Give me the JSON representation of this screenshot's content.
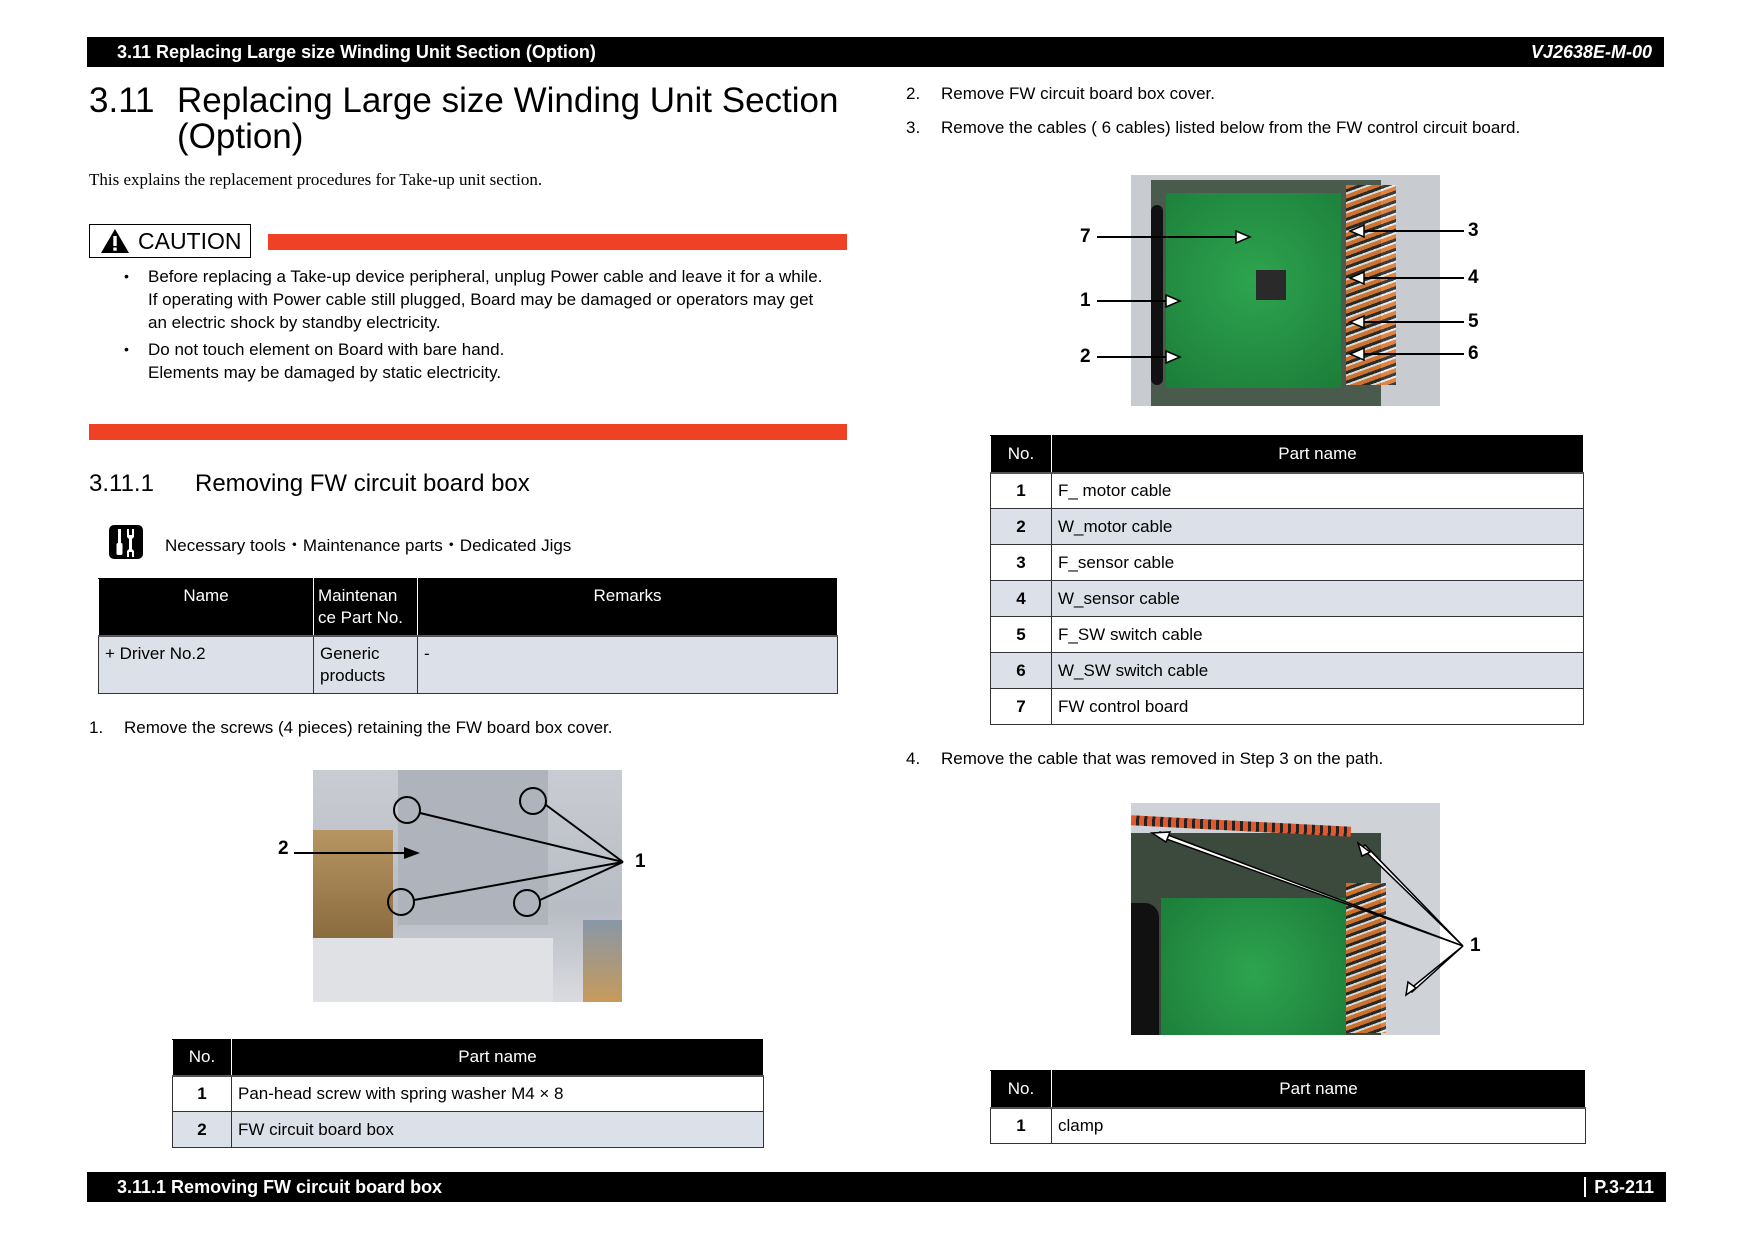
{
  "header": {
    "section": "3.11 Replacing Large size Winding Unit Section (Option)",
    "doc_code": "VJ2638E-M-00"
  },
  "title": {
    "number": "3.11",
    "text": "Replacing Large size Winding Unit Section (Option)"
  },
  "intro": "This explains the replacement procedures for Take-up unit section.",
  "caution": {
    "label": "CAUTION",
    "items": [
      {
        "line1": "Before replacing a Take-up device peripheral, unplug Power cable and leave it for a while.",
        "line2": "If operating with Power cable still plugged, Board may be damaged or operators may get an electric shock by standby electricity."
      },
      {
        "line1": "Do not touch element on Board with bare hand.",
        "line2": "Elements may be damaged by static electricity."
      }
    ],
    "accent_color": "#EF4123"
  },
  "subsection": {
    "number": "3.11.1",
    "title": "Removing FW circuit board box"
  },
  "tools": {
    "icon": "tools-icon",
    "label": "Necessary tools・Maintenance parts・Dedicated Jigs",
    "headers": [
      "Name",
      "Maintenance Part No.",
      "Remarks"
    ],
    "header_wrapped": [
      "Name",
      "Maintenan ce Part No.",
      "Remarks"
    ],
    "rows": [
      {
        "name": "+ Driver No.2",
        "part_no": "Generic products",
        "remarks": "-"
      }
    ]
  },
  "steps": [
    {
      "num": "1.",
      "text": "Remove the screws (4 pieces) retaining the FW board box cover."
    },
    {
      "num": "2.",
      "text": "Remove FW circuit board box cover."
    },
    {
      "num": "3.",
      "text": "Remove the cables ( 6 cables) listed below from the FW control circuit board."
    },
    {
      "num": "4.",
      "text": "Remove the cable that was removed in Step 3 on the path."
    }
  ],
  "figure1": {
    "callouts": [
      "1",
      "2"
    ],
    "table": {
      "headers": [
        "No.",
        "Part name"
      ],
      "rows": [
        {
          "no": "1",
          "name": "Pan-head screw with spring washer M4 × 8"
        },
        {
          "no": "2",
          "name": "FW circuit board box"
        }
      ]
    }
  },
  "figure2": {
    "callouts": [
      "1",
      "2",
      "3",
      "4",
      "5",
      "6",
      "7"
    ],
    "table": {
      "headers": [
        "No.",
        "Part name"
      ],
      "rows": [
        {
          "no": "1",
          "name": "F_ motor cable"
        },
        {
          "no": "2",
          "name": "W_motor cable"
        },
        {
          "no": "3",
          "name": "F_sensor cable"
        },
        {
          "no": "4",
          "name": "W_sensor cable"
        },
        {
          "no": "5",
          "name": "F_SW switch cable"
        },
        {
          "no": "6",
          "name": "W_SW switch cable"
        },
        {
          "no": "7",
          "name": "FW control board"
        }
      ]
    }
  },
  "figure3": {
    "callouts": [
      "1"
    ],
    "table": {
      "headers": [
        "No.",
        "Part name"
      ],
      "rows": [
        {
          "no": "1",
          "name": "clamp"
        }
      ]
    }
  },
  "footer": {
    "section": "3.11.1 Removing FW circuit board box",
    "page": "P.3-211"
  }
}
